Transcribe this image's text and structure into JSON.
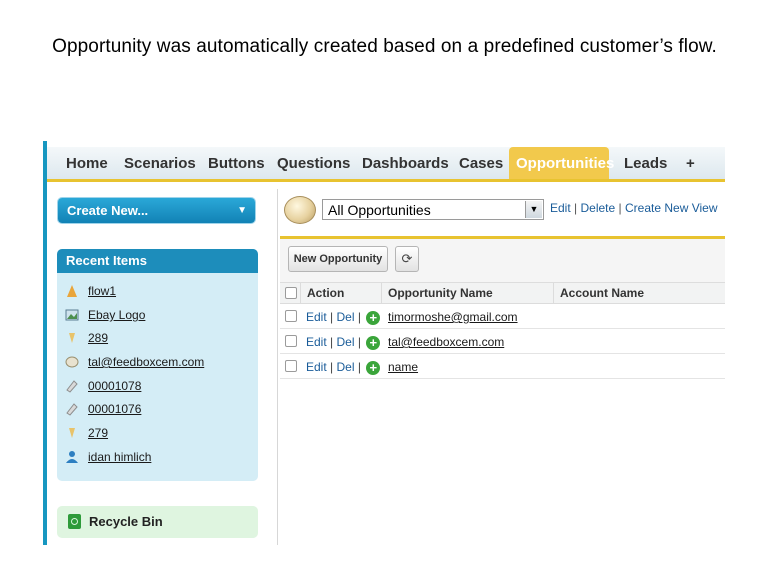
{
  "caption": "Opportunity was automatically created based on a predefined customer’s flow.",
  "tabs": [
    {
      "label": "Home"
    },
    {
      "label": "Scenarios"
    },
    {
      "label": "Buttons"
    },
    {
      "label": "Questions"
    },
    {
      "label": "Dashboards"
    },
    {
      "label": "Cases"
    },
    {
      "label": "Opportunities",
      "active": true
    },
    {
      "label": "Leads"
    },
    {
      "label": "+"
    }
  ],
  "sidebar": {
    "create_new": "Create New...",
    "recent_title": "Recent Items",
    "recent_items": [
      {
        "label": "flow1",
        "icon": "flow-icon"
      },
      {
        "label": "Ebay Logo",
        "icon": "image-icon"
      },
      {
        "label": "289",
        "icon": "case-icon"
      },
      {
        "label": "tal@feedboxcem.com",
        "icon": "opportunity-icon"
      },
      {
        "label": "00001078",
        "icon": "record-icon"
      },
      {
        "label": "00001076",
        "icon": "record-icon"
      },
      {
        "label": "279",
        "icon": "case-icon"
      },
      {
        "label": "idan himlich",
        "icon": "user-icon"
      }
    ],
    "recycle_bin": "Recycle Bin"
  },
  "view": {
    "selected": "All Opportunities",
    "edit": "Edit",
    "delete": "Delete",
    "create_new_view": "Create New View"
  },
  "toolbar": {
    "new_opportunity": "New Opportunity"
  },
  "table": {
    "headers": [
      "Action",
      "Opportunity Name",
      "Account Name"
    ],
    "action_edit": "Edit",
    "action_del": "Del",
    "rows": [
      {
        "name": "timormoshe@gmail.com"
      },
      {
        "name": "tal@feedboxcem.com"
      },
      {
        "name": "name"
      }
    ]
  },
  "colors": {
    "accent": "#1d8dbb",
    "active_tab": "#f2c94c",
    "link": "#1a5c99"
  }
}
